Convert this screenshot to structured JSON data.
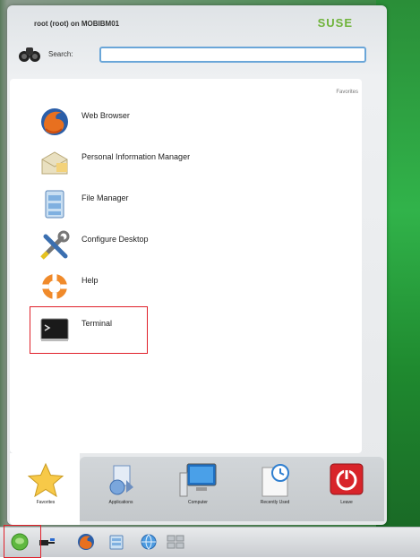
{
  "header": {
    "user_host": "root (root) on MOBIBM01",
    "brand": "SUSE",
    "search_label": "Search:",
    "search_value": ""
  },
  "panel": {
    "title": "Favorites",
    "items": [
      {
        "label": "Web Browser",
        "icon": "firefox-icon"
      },
      {
        "label": "Personal Information Manager",
        "icon": "pim-icon"
      },
      {
        "label": "File Manager",
        "icon": "file-manager-icon"
      },
      {
        "label": "Configure Desktop",
        "icon": "tools-icon"
      },
      {
        "label": "Help",
        "icon": "lifebuoy-icon"
      },
      {
        "label": "Terminal",
        "icon": "terminal-icon"
      }
    ]
  },
  "tabs": [
    {
      "label": "Favorites",
      "icon": "star-icon",
      "selected": true
    },
    {
      "label": "Applications",
      "icon": "applications-icon",
      "selected": false
    },
    {
      "label": "Computer",
      "icon": "computer-icon",
      "selected": false
    },
    {
      "label": "Recently Used",
      "icon": "recent-icon",
      "selected": false
    },
    {
      "label": "Leave",
      "icon": "power-icon",
      "selected": false
    }
  ],
  "taskbar": {
    "items": [
      "start-menu-icon",
      "network-icon",
      "firefox-icon",
      "file-manager-icon",
      "browser-icon",
      "desktop-pager-icon"
    ]
  },
  "colors": {
    "brand": "#6fb33a",
    "highlight_border": "#e0202a",
    "search_border": "#6aa6d8"
  }
}
